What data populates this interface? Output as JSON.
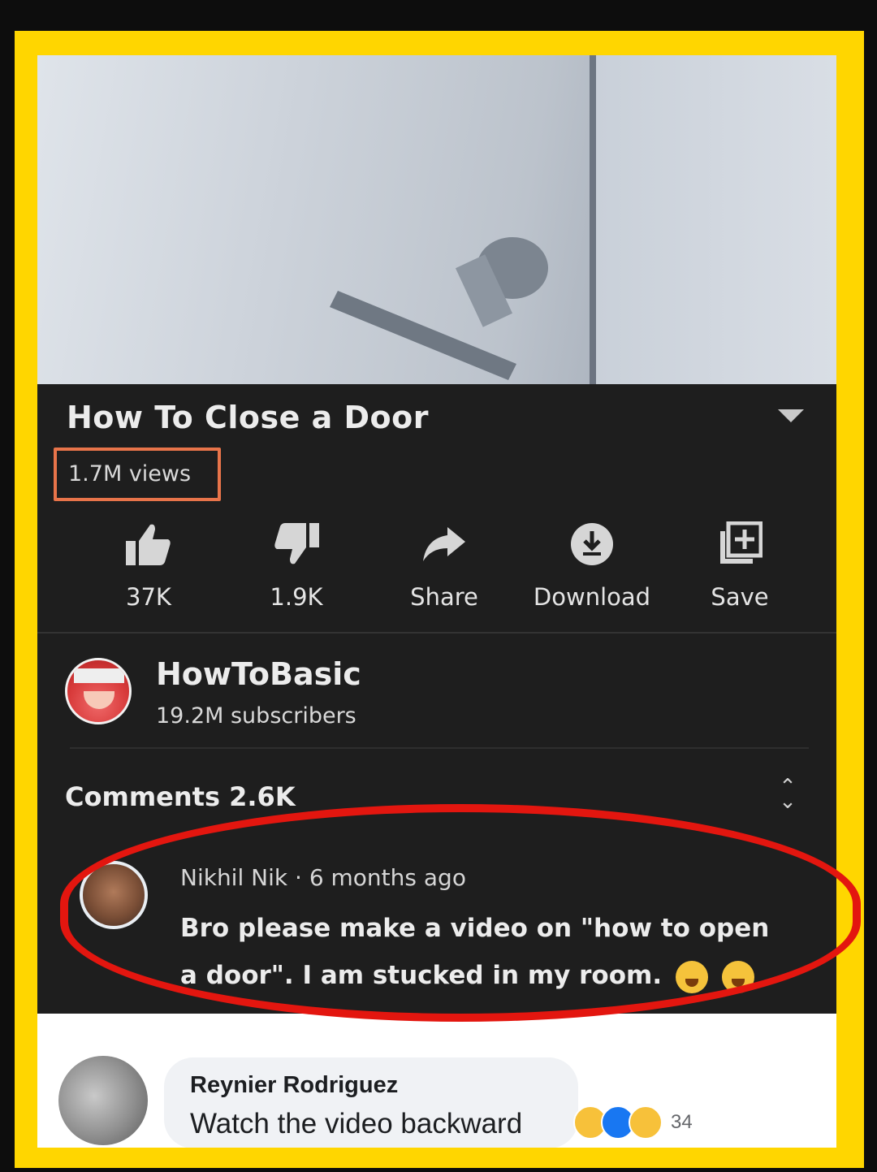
{
  "video": {
    "title": "How To Close a Door",
    "views": "1.7M views"
  },
  "actions": [
    {
      "label": "37K",
      "icon": "thumbs-up-icon"
    },
    {
      "label": "1.9K",
      "icon": "thumbs-down-icon"
    },
    {
      "label": "Share",
      "icon": "share-arrow-icon"
    },
    {
      "label": "Download",
      "icon": "download-icon"
    },
    {
      "label": "Save",
      "icon": "add-to-playlist-icon"
    }
  ],
  "channel": {
    "name": "HowToBasic",
    "subscribers": "19.2M subscribers"
  },
  "comments": {
    "header": "Comments 2.6K",
    "top": {
      "author": "Nikhil Nik",
      "time": "6 months ago",
      "text": "Bro please make a video on \"how to open a door\". I am stucked in my room."
    }
  },
  "fb_comment": {
    "author": "Reynier Rodriguez",
    "text": "Watch the video backward",
    "reaction_count": "34",
    "reactions": [
      "haha",
      "like",
      "wow"
    ]
  },
  "colors": {
    "frame": "#ffd600",
    "highlight_box": "#e8744a",
    "red_circle": "#e3160f",
    "panel": "#1e1e1e"
  }
}
